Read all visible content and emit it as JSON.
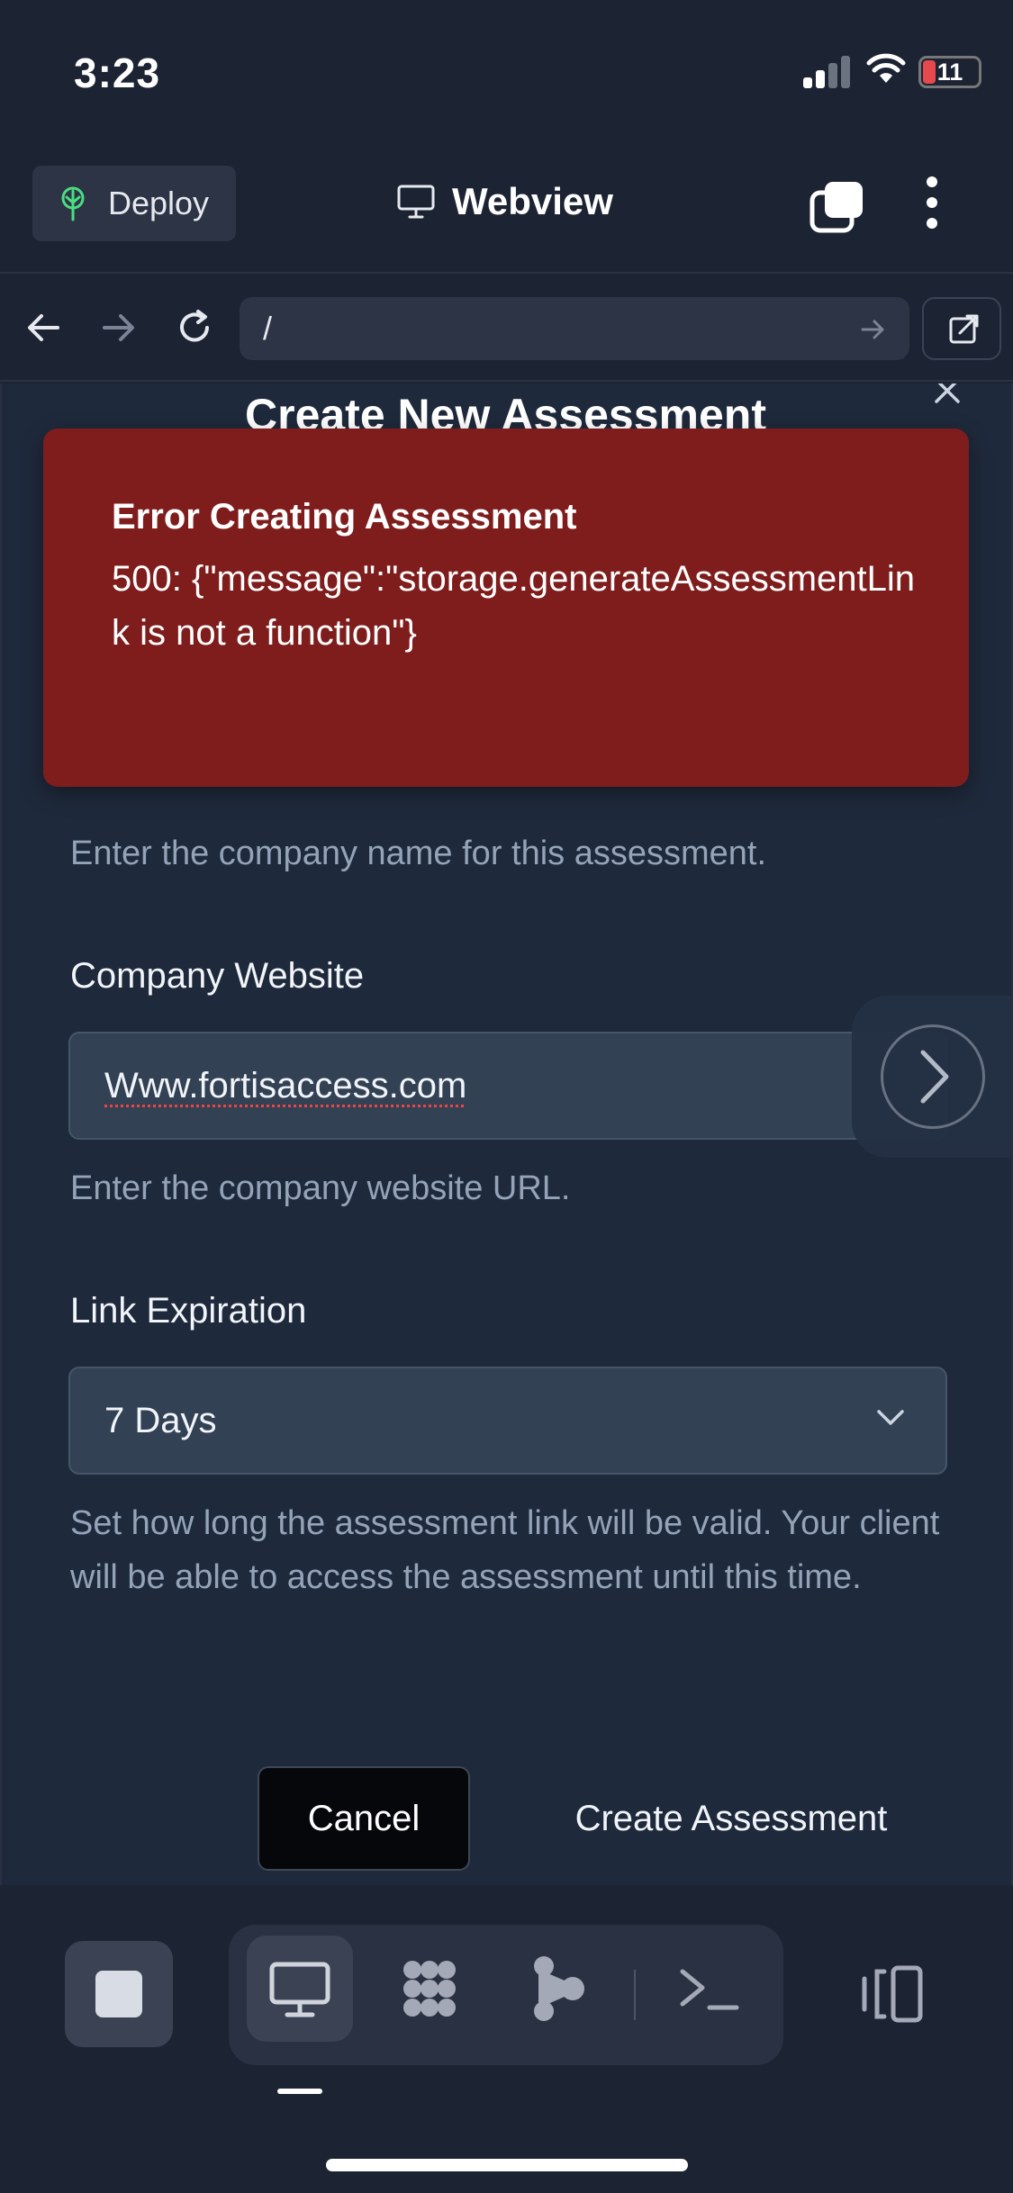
{
  "status_bar": {
    "time": "3:23",
    "battery": "11"
  },
  "header": {
    "deploy_label": "Deploy",
    "title": "Webview"
  },
  "url_bar": {
    "url": "/"
  },
  "modal": {
    "title": "Create New Assessment",
    "company_name_help": "Enter the company name for this assessment.",
    "website": {
      "label": "Company Website",
      "value": "Www.fortisaccess.com",
      "help": "Enter the company website URL."
    },
    "expiration": {
      "label": "Link Expiration",
      "value": "7 Days",
      "help": "Set how long the assessment link will be valid. Your client will be able to access the assessment until this time."
    },
    "cancel_label": "Cancel",
    "create_label": "Create Assessment"
  },
  "toast": {
    "title": "Error Creating Assessment",
    "message": "500: {\"message\":\"storage.generateAssessmentLink is not a function\"}"
  },
  "colors": {
    "background": "#1c2333",
    "panel": "#1e293b",
    "error": "#7f1d1d",
    "input": "#334155"
  },
  "toolbar": {
    "items": [
      "stop-icon",
      "monitor-icon",
      "dots-grid-icon",
      "share-nodes-icon",
      "terminal-icon",
      "panel-toggle-icon"
    ]
  }
}
